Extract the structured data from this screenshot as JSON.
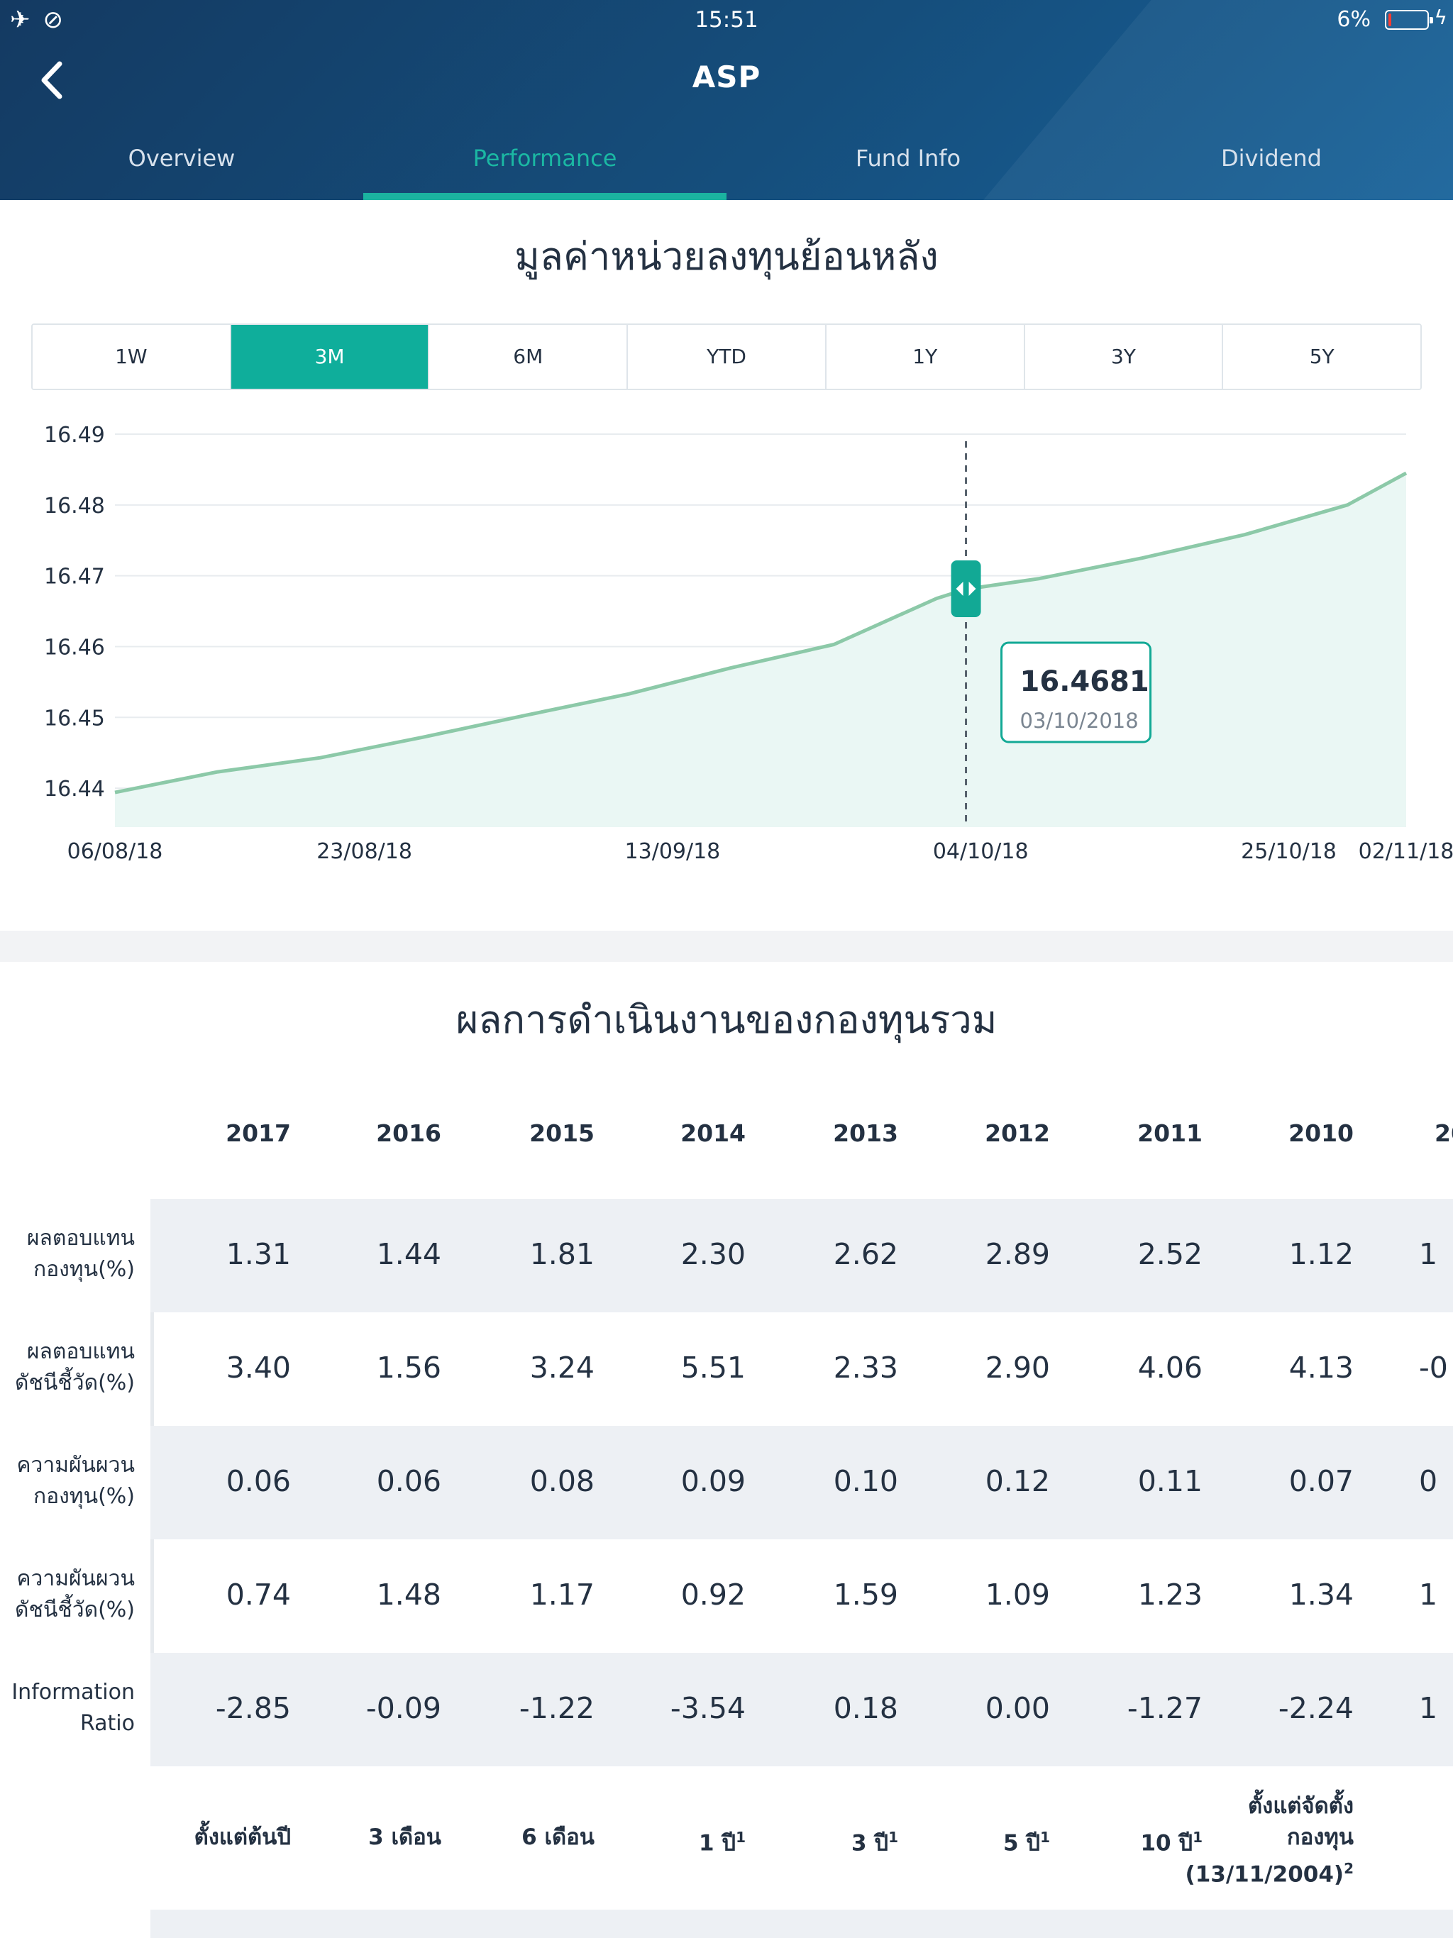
{
  "status_bar": {
    "time": "15:51",
    "battery_pct": "6%",
    "battery_level": 0.06
  },
  "nav": {
    "title": "ASP"
  },
  "tabs": [
    {
      "label": "Overview",
      "active": false
    },
    {
      "label": "Performance",
      "active": true
    },
    {
      "label": "Fund Info",
      "active": false
    },
    {
      "label": "Dividend",
      "active": false
    }
  ],
  "chart_section": {
    "title": "มูลค่าหน่วยลงทุนย้อนหลัง",
    "ranges": [
      {
        "label": "1W",
        "active": false
      },
      {
        "label": "3M",
        "active": true
      },
      {
        "label": "6M",
        "active": false
      },
      {
        "label": "YTD",
        "active": false
      },
      {
        "label": "1Y",
        "active": false
      },
      {
        "label": "3Y",
        "active": false
      },
      {
        "label": "5Y",
        "active": false
      }
    ]
  },
  "chart_data": {
    "type": "area",
    "x_ticks": [
      "06/08/18",
      "23/08/18",
      "13/09/18",
      "04/10/18",
      "25/10/18",
      "02/11/18"
    ],
    "y_ticks": [
      "16.49",
      "16.48",
      "16.47",
      "16.46",
      "16.45",
      "16.44"
    ],
    "ylim": [
      16.4345,
      16.49
    ],
    "xlim": [
      "2018-08-06",
      "2018-11-02"
    ],
    "series": [
      {
        "x": [
          "2018-08-06",
          "2018-08-13",
          "2018-08-20",
          "2018-08-27",
          "2018-09-03",
          "2018-09-10",
          "2018-09-17",
          "2018-09-24",
          "2018-10-01",
          "2018-10-03",
          "2018-10-08",
          "2018-10-15",
          "2018-10-22",
          "2018-10-29",
          "2018-11-02"
        ],
        "values": [
          16.4394,
          16.4423,
          16.4443,
          16.4472,
          16.4503,
          16.4533,
          16.457,
          16.4603,
          16.4668,
          16.4681,
          16.4696,
          16.4725,
          16.4758,
          16.48,
          16.4845
        ]
      }
    ],
    "grid": true,
    "color": "#8cc9a8",
    "fill": "#eaf7f4",
    "cursor": {
      "x": "2018-10-03",
      "value": "16.4681",
      "date": "03/10/2018"
    }
  },
  "performance": {
    "title": "ผลการดำเนินงานของกองทุนรวม",
    "years": [
      "2017",
      "2016",
      "2015",
      "2014",
      "2013",
      "2012",
      "2011",
      "2010",
      "20"
    ],
    "rows": [
      {
        "label": "ผลตอบแทน\nกองทุน(%)",
        "values": [
          "1.31",
          "1.44",
          "1.81",
          "2.30",
          "2.62",
          "2.89",
          "2.52",
          "1.12",
          "1"
        ]
      },
      {
        "label": "ผลตอบแทน\nดัชนีชี้วัด(%)",
        "values": [
          "3.40",
          "1.56",
          "3.24",
          "5.51",
          "2.33",
          "2.90",
          "4.06",
          "4.13",
          "-0"
        ]
      },
      {
        "label": "ความผันผวน\nกองทุน(%)",
        "values": [
          "0.06",
          "0.06",
          "0.08",
          "0.09",
          "0.10",
          "0.12",
          "0.11",
          "0.07",
          "0"
        ]
      },
      {
        "label": "ความผันผวน\nดัชนีชี้วัด(%)",
        "values": [
          "0.74",
          "1.48",
          "1.17",
          "0.92",
          "1.59",
          "1.09",
          "1.23",
          "1.34",
          "1"
        ]
      },
      {
        "label": "Information\nRatio",
        "values": [
          "-2.85",
          "-0.09",
          "-1.22",
          "-3.54",
          "0.18",
          "0.00",
          "-1.27",
          "-2.24",
          "1"
        ]
      }
    ],
    "periods": [
      {
        "label": "ตั้งแต่ต้นปี",
        "sup": ""
      },
      {
        "label": "3 เดือน",
        "sup": ""
      },
      {
        "label": "6 เดือน",
        "sup": ""
      },
      {
        "label": "1 ปี",
        "sup": "1"
      },
      {
        "label": "3 ปี",
        "sup": "1"
      },
      {
        "label": "5 ปี",
        "sup": "1"
      },
      {
        "label": "10 ปี",
        "sup": "1"
      },
      {
        "label": "ตั้งแต่จัดตั้ง\nกองทุน\n(13/11/2004)",
        "sup": "2"
      }
    ]
  }
}
